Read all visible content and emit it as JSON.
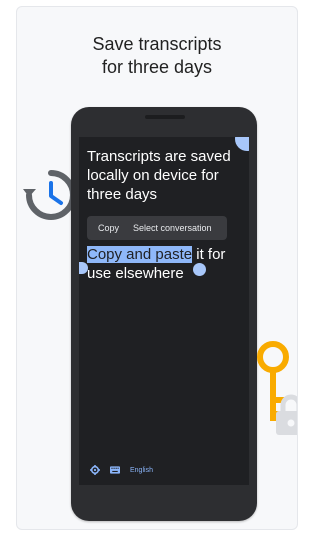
{
  "headline": {
    "line1": "Save transcripts",
    "line2": "for three days"
  },
  "phone": {
    "transcript_text": "Transcripts are saved locally on device for three days",
    "context_menu": {
      "copy_label": "Copy",
      "select_label": "Select conversation"
    },
    "selection": {
      "selected_text": "Copy and paste",
      "rest_text": " it for use elsewhere"
    },
    "bottom_bar": {
      "settings_icon": "gear-icon",
      "keyboard_icon": "keyboard-icon",
      "language_label": "English"
    }
  },
  "decorations": {
    "left_icon": "history-clock-icon",
    "right_icons": [
      "key-icon",
      "lock-icon"
    ]
  },
  "colors": {
    "selection_blue": "#8fb8f9",
    "accent_blue": "#1a73e8",
    "key_yellow": "#f9ab00",
    "screen_dark": "#1f2023"
  }
}
